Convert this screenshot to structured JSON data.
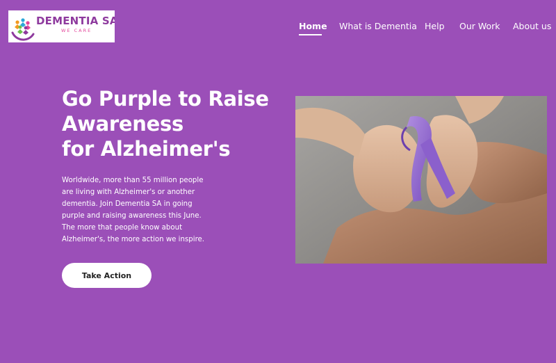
{
  "logo": {
    "name": "DEMENTIA SA",
    "tagline": "WE CARE"
  },
  "nav": {
    "items": [
      {
        "label": "Home",
        "active": true
      },
      {
        "label": "What is Dementia",
        "active": false
      },
      {
        "label": "Help",
        "active": false
      },
      {
        "label": "Our Work",
        "active": false
      },
      {
        "label": "About us",
        "active": false
      }
    ]
  },
  "hero": {
    "title_lines": [
      "Go Purple to Raise",
      "Awareness",
      "for Alzheimer's"
    ],
    "body": "Worldwide, more than 55 million people are living with Alzheimer's or another dementia. Join Dementia SA in going purple and raising awareness this June. The more that people know about Alzheimer's, the more action we inspire.",
    "cta_label": "Take Action",
    "image_icon": "hands-holding-purple-ribbon"
  },
  "colors": {
    "background": "#9b4fb8",
    "brand_purple": "#8e3a9e",
    "brand_pink": "#e3459a",
    "button_bg": "#ffffff",
    "ribbon": "#9c72cf"
  }
}
